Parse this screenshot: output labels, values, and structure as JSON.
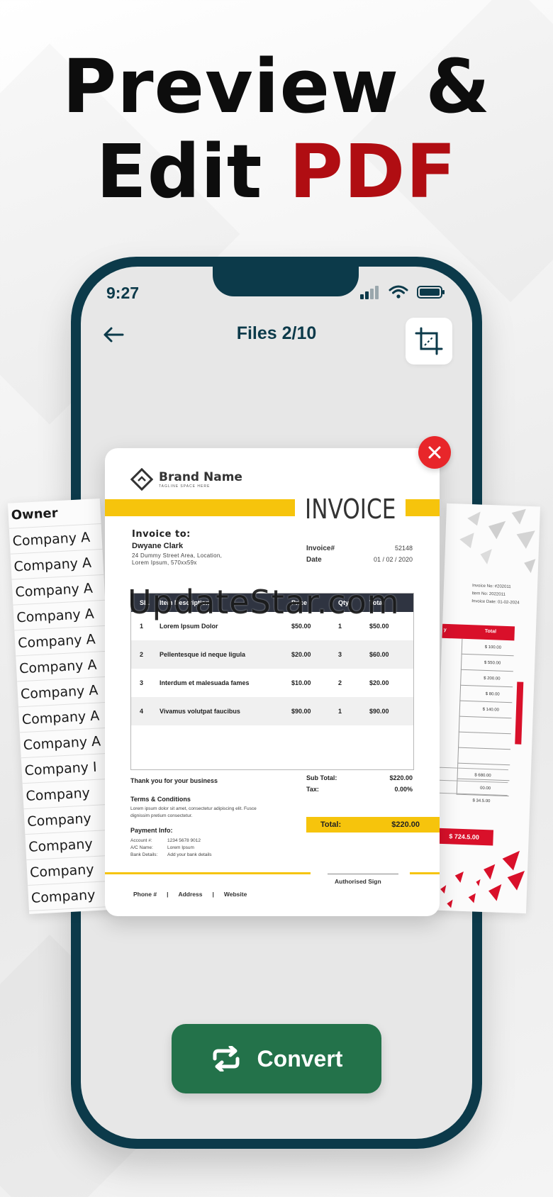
{
  "headline": {
    "line1": "Preview &",
    "line2_plain": "Edit ",
    "line2_red": "PDF"
  },
  "colors": {
    "brand_red": "#b00d12",
    "phone_frame": "#0c3a4a",
    "convert_green": "#23724a",
    "invoice_yellow": "#f6c40c",
    "close_red": "#e8262a"
  },
  "status": {
    "time": "9:27"
  },
  "topbar": {
    "title": "Files 2/10",
    "back_icon": "arrow-left-icon",
    "crop_icon": "crop-icon"
  },
  "convert": {
    "label": "Convert",
    "icon": "repeat-icon"
  },
  "left_page": {
    "rows": [
      "Owner",
      "Company A",
      "Company A",
      "Company A",
      "Company A",
      "Company A",
      "Company A",
      "Company A",
      "Company A",
      "Company A",
      "Company I",
      "Company",
      "Company",
      "Company",
      "Company",
      "Company"
    ]
  },
  "right_page": {
    "meta": [
      "Invoice No: #202011",
      "Item No: 2022011",
      "Invoice Date: 01-02-2024"
    ],
    "col_y": "y",
    "col_total": "Total",
    "rows": [
      "$ 100.00",
      "$ 550.00",
      "$ 200.00",
      "$ 80.00",
      "$ 140.00"
    ],
    "footer": [
      "$ 680.00",
      "00.00",
      "$ 34.5.00"
    ],
    "grand_total": "$ 724.5.00"
  },
  "invoice": {
    "brand_name": "Brand Name",
    "brand_tag": "TAGLINE SPACE HERE",
    "title": "INVOICE",
    "to_label": "Invoice to:",
    "to_name": "Dwyane Clark",
    "to_address": "24 Dummy Street Area, Location, Lorem Ipsum, 570xx59x",
    "invoice_no_label": "Invoice#",
    "invoice_no": "52148",
    "date_label": "Date",
    "date": "01 / 02 / 2020",
    "columns": [
      "SL.",
      "Item Description",
      "Price",
      "Qty.",
      "Total"
    ],
    "rows": [
      [
        "1",
        "Lorem Ipsum Dolor",
        "$50.00",
        "1",
        "$50.00"
      ],
      [
        "2",
        "Pellentesque id neque ligula",
        "$20.00",
        "3",
        "$60.00"
      ],
      [
        "3",
        "Interdum et malesuada fames",
        "$10.00",
        "2",
        "$20.00"
      ],
      [
        "4",
        "Vivamus volutpat faucibus",
        "$90.00",
        "1",
        "$90.00"
      ]
    ],
    "thanks": "Thank you for your business",
    "terms_title": "Terms & Conditions",
    "terms_text": "Lorem ipsum dolor sit amet, consectetur adipiscing elit. Fusce dignissim pretium consectetur.",
    "sub_total_label": "Sub Total:",
    "sub_total": "$220.00",
    "tax_label": "Tax:",
    "tax": "0.00%",
    "total_label": "Total:",
    "total": "$220.00",
    "payment_title": "Payment Info:",
    "account_label": "Account #:",
    "account": "1234 5678 9012",
    "ac_name_label": "A/C Name:",
    "ac_name": "Lorem Ipsum",
    "bank_label": "Bank Details:",
    "bank": "Add your bank details",
    "sign": "Authorised Sign",
    "phone": "Phone #",
    "address": "Address",
    "website": "Website",
    "sep": "|"
  },
  "watermark": "UpdateStar.com"
}
